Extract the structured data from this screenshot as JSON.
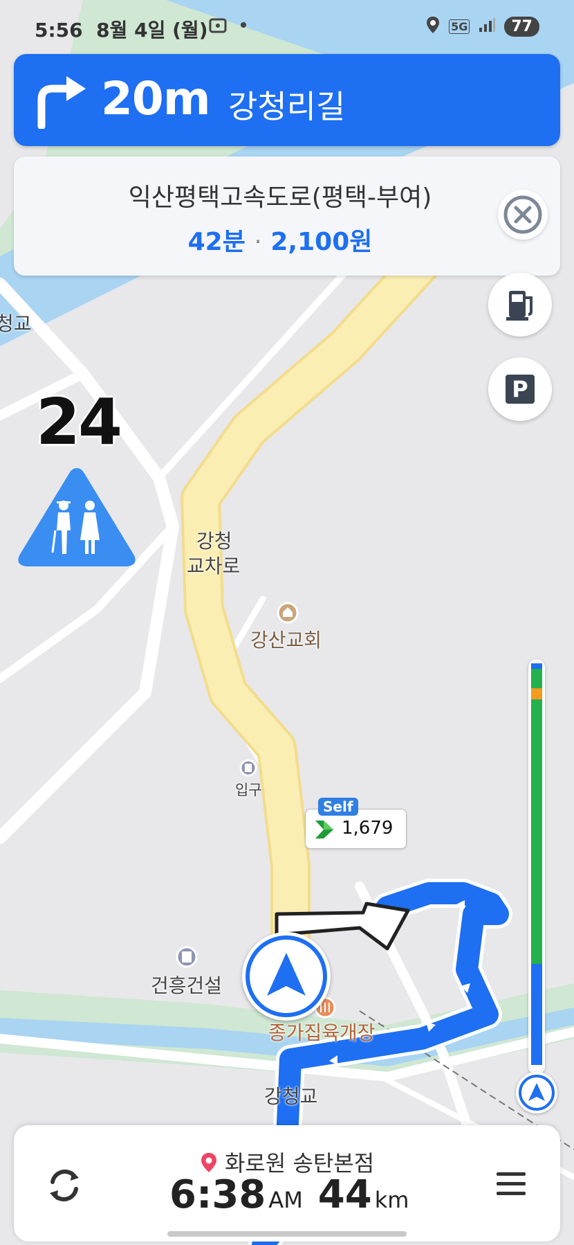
{
  "status_bar": {
    "time": "5:56",
    "date": "8월 4일 (월)",
    "network": "5G",
    "battery": "77"
  },
  "turn_banner": {
    "direction_icon": "turn-right-arrow-icon",
    "distance": "20m",
    "road": "강청리길",
    "color": "#1e6ff1"
  },
  "route_card": {
    "route_name": "익산평택고속도로(평택-부여)",
    "duration": "42분",
    "separator": "·",
    "toll": "2,100원",
    "close_icon": "close-circle-icon"
  },
  "side_buttons": {
    "gas_icon": "gas-station-icon",
    "parking_label": "P"
  },
  "speed_limit": {
    "value": "24",
    "warning_icon": "elderly-zone-icon"
  },
  "map_labels": {
    "bridge_top": "청교",
    "interchange_line1": "강청",
    "interchange_line2": "교차로",
    "church": "강산교회",
    "entrance": "입구",
    "company": "건흥건설",
    "restaurant": "종가집육개장",
    "bridge_bottom": "강청교"
  },
  "gas_price": {
    "self_badge": "Self",
    "price": "1,679"
  },
  "trip_progress": {
    "traffic_colors": [
      "#1e6ff1",
      "#22b14c",
      "#f39a20",
      "#22b14c",
      "#1e6ff1"
    ],
    "icon": "current-position-icon"
  },
  "bottom_panel": {
    "destination": "화로원 송탄본점",
    "arrival_time": "6:38",
    "arrival_period": "AM",
    "remaining_distance": "44",
    "distance_unit": "km",
    "reroute_icon": "refresh-icon",
    "menu_icon": "menu-icon"
  }
}
